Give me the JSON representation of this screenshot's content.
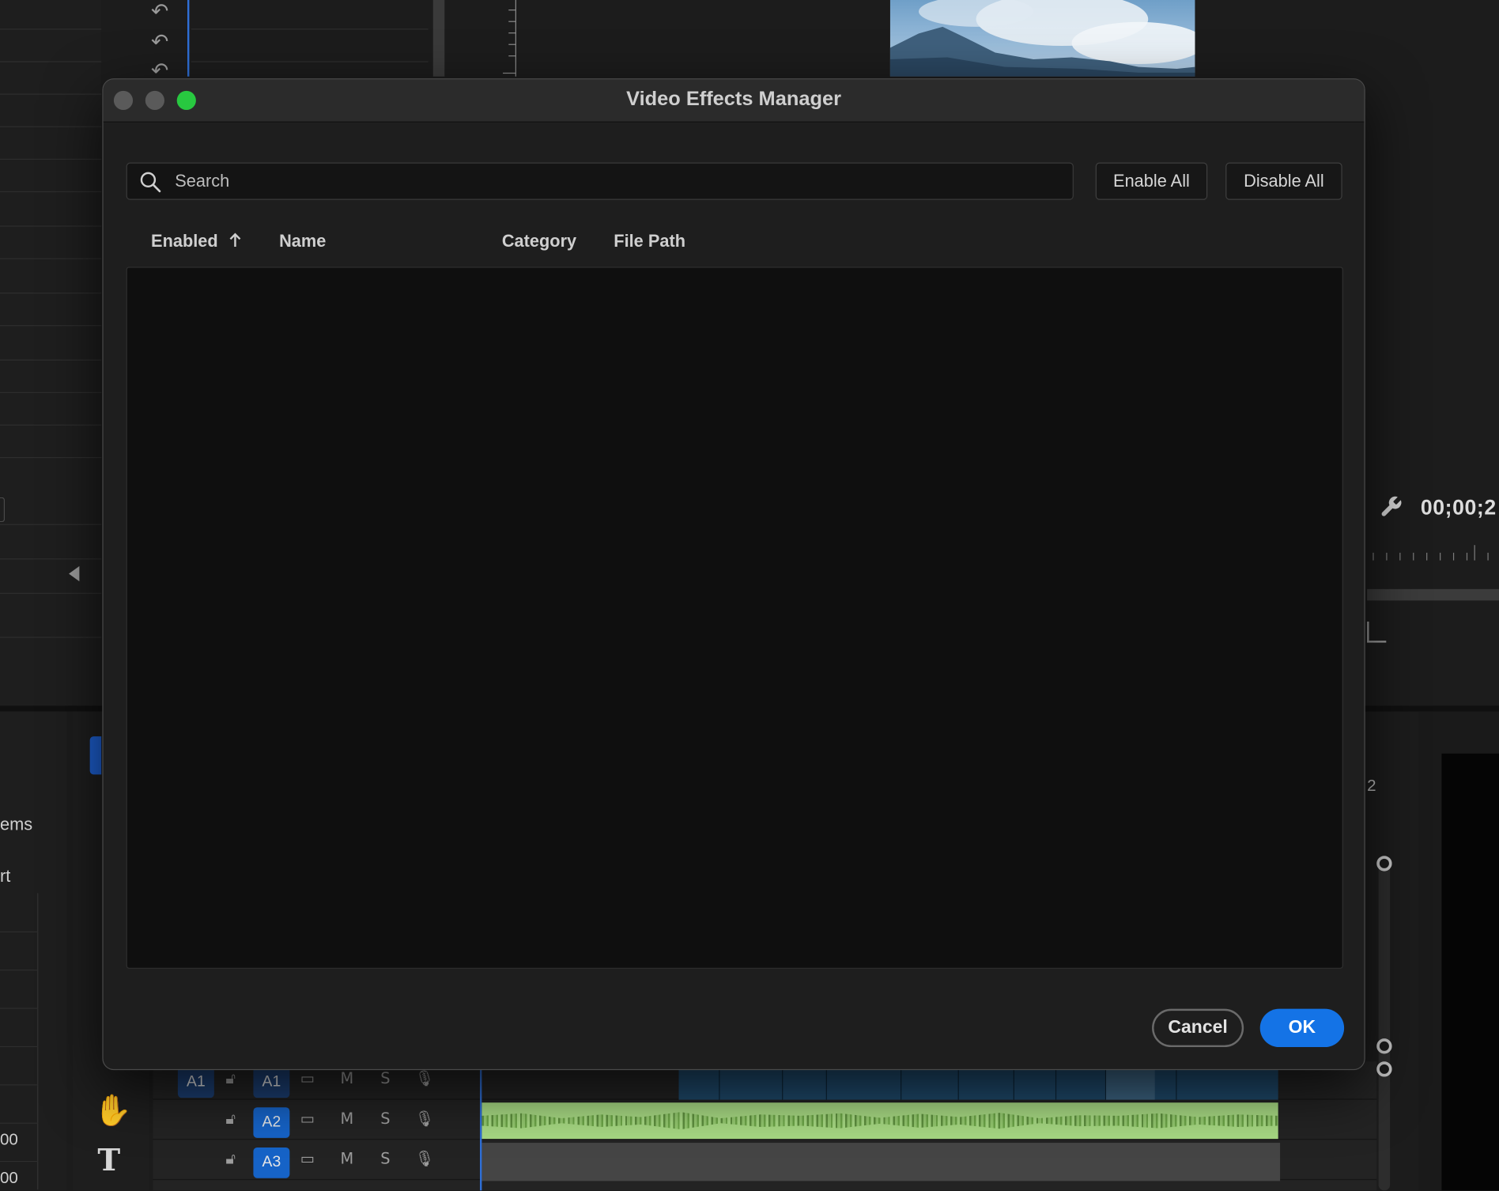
{
  "dialog": {
    "title": "Video Effects Manager",
    "search": {
      "placeholder": "Search"
    },
    "buttons": {
      "enable_all": "Enable All",
      "disable_all": "Disable All",
      "cancel": "Cancel",
      "ok": "OK"
    },
    "columns": [
      {
        "label": "Enabled",
        "sort": "ascending"
      },
      {
        "label": "Name"
      },
      {
        "label": "Category"
      },
      {
        "label": "File Path"
      }
    ],
    "rows": []
  },
  "background": {
    "timecode": "00;00;2",
    "left_labels": [
      "ems",
      "rt"
    ],
    "left_values": [
      "00",
      "00"
    ],
    "tick_label": "2",
    "tracks": [
      {
        "source": "A1",
        "target": "A1",
        "mute": "M",
        "solo": "S"
      },
      {
        "target": "A2",
        "mute": "M",
        "solo": "S"
      },
      {
        "target": "A3",
        "mute": "M",
        "solo": "S"
      }
    ]
  },
  "colors": {
    "accent": "#1473e6",
    "close": "#5a5a5a",
    "minimize": "#5a5a5a",
    "zoom": "#28c840",
    "audio_clip": "#a7d983",
    "video_clip": "#1f4a6c"
  },
  "icons": {
    "search": "search-icon",
    "sort": "arrow-up-icon",
    "wrench": "wrench-icon",
    "hand": "hand-tool-icon",
    "type": "type-tool-icon",
    "lock": "lock-icon",
    "mic": "microphone-icon"
  }
}
